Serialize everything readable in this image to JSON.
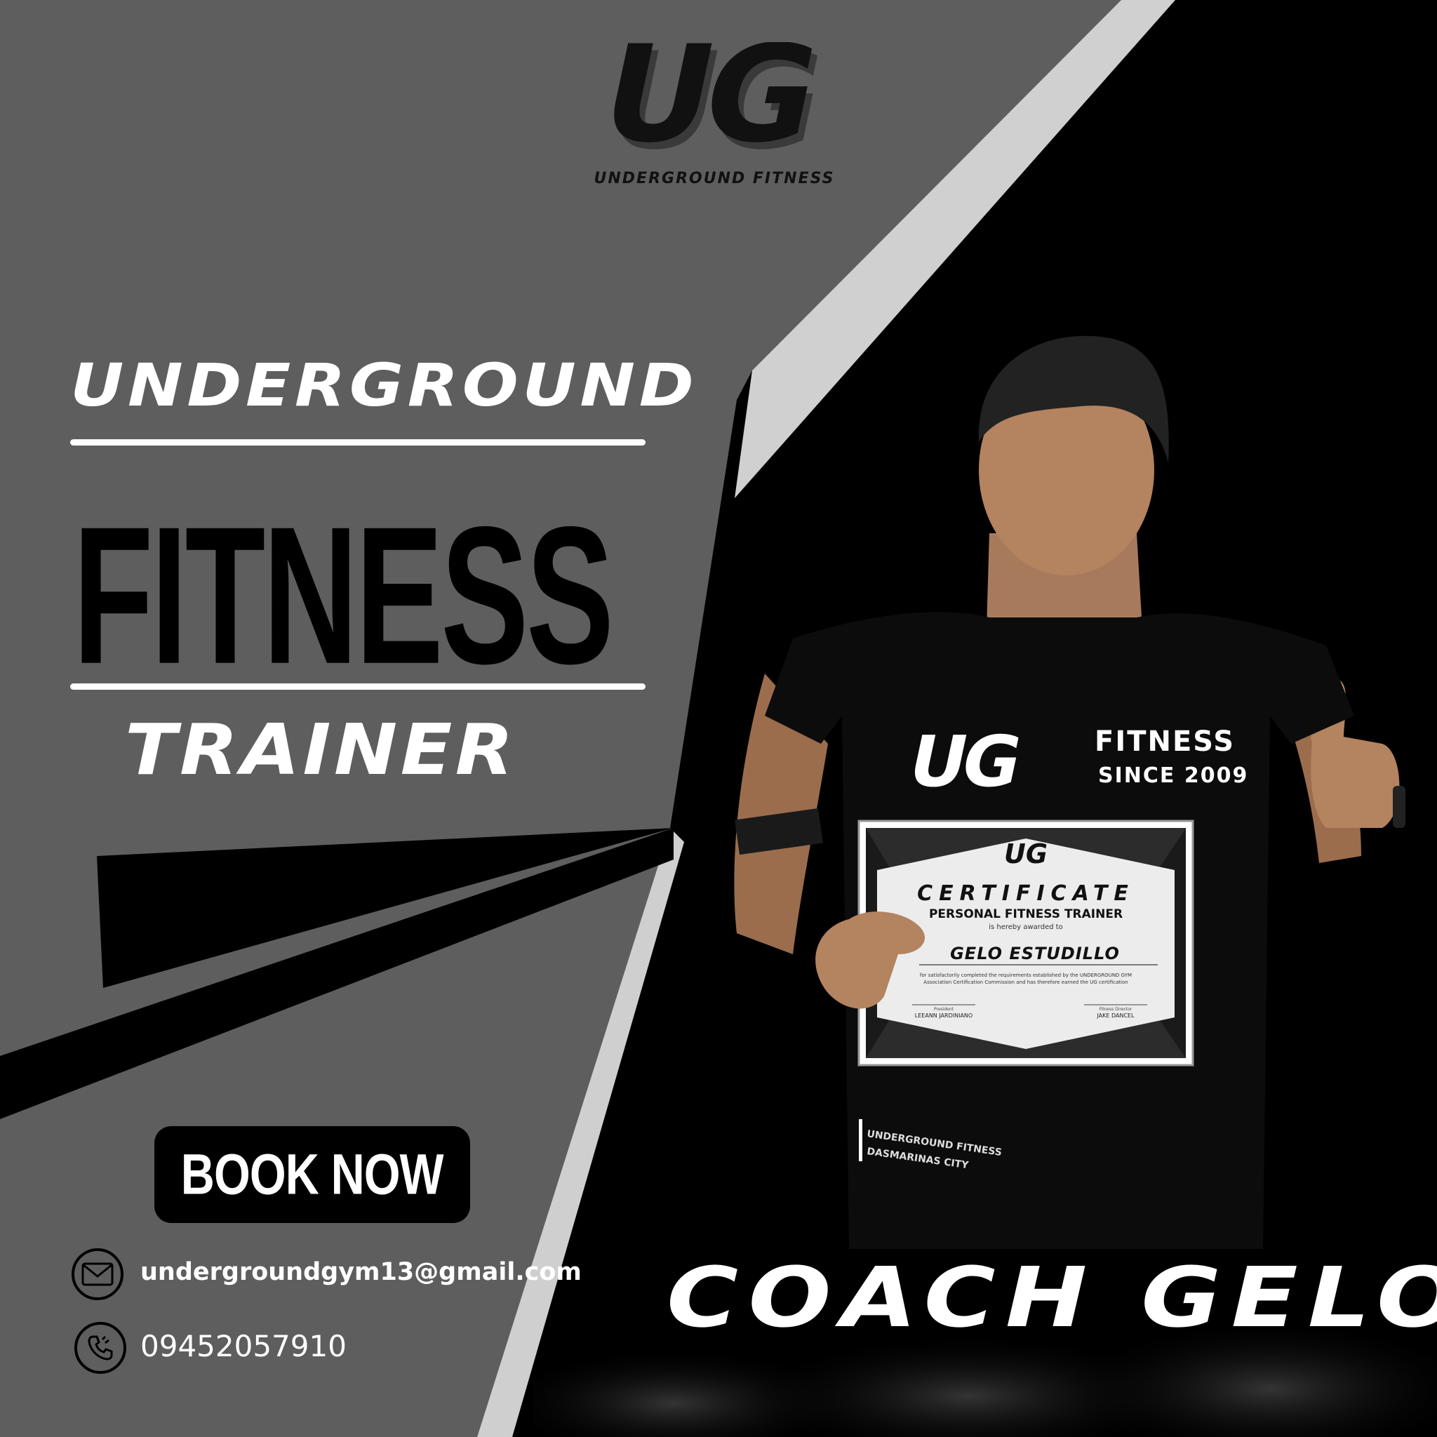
{
  "brand": {
    "logo_letters": "UG",
    "logo_tagline": "UNDERGROUND FITNESS"
  },
  "headline": {
    "line1": "UNDERGROUND",
    "line2": "FITNESS",
    "line3": "TRAINER"
  },
  "cta": {
    "label": "BOOK NOW"
  },
  "contact": {
    "email": "undergroundgym13@gmail.com",
    "phone": "09452057910",
    "email_icon": "envelope-icon",
    "phone_icon": "phone-icon"
  },
  "shirt": {
    "logo": "UG",
    "line1": "FITNESS",
    "line2": "SINCE 2009",
    "hem1": "UNDERGROUND FITNESS",
    "hem2": "DASMARINAS CITY"
  },
  "certificate": {
    "logo": "UG",
    "title": "CERTIFICATE",
    "subtitle": "PERSONAL FITNESS TRAINER",
    "awarded": "is hereby awarded to",
    "recipient": "GELO ESTUDILLO",
    "body1": "for satisfactorily completed the requirements established by the UNDERGROUND GYM",
    "body2": "Association Certification Commission and has therefore earned the UG certification",
    "sig1_role": "President",
    "sig1_name": "LEEANN JARDINIANO",
    "sig2_role": "Fitness Director",
    "sig2_name": "JAKE DANCEL"
  },
  "coach": {
    "name": "COACH GELO"
  },
  "colors": {
    "panel_gray": "#5e5e5e",
    "stripe_light": "#cfcfcf",
    "black": "#000000",
    "white": "#ffffff"
  }
}
